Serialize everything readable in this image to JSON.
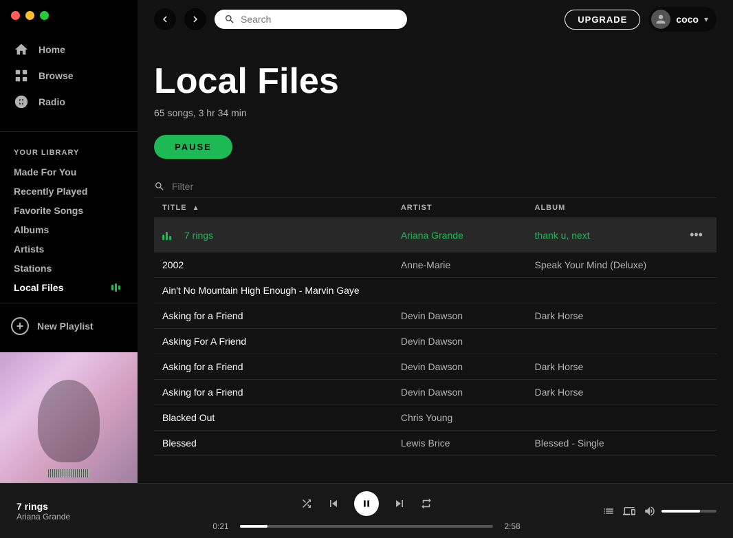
{
  "window": {
    "dots": [
      "red",
      "yellow",
      "green"
    ]
  },
  "topbar": {
    "search_placeholder": "Search",
    "upgrade_label": "UPGRADE",
    "user_name": "coco"
  },
  "sidebar": {
    "nav_items": [
      {
        "label": "Home",
        "icon": "home-icon"
      },
      {
        "label": "Browse",
        "icon": "browse-icon"
      },
      {
        "label": "Radio",
        "icon": "radio-icon"
      }
    ],
    "section_title": "YOUR LIBRARY",
    "library_items": [
      {
        "label": "Made For You",
        "key": "made-for-you"
      },
      {
        "label": "Recently Played",
        "key": "recently-played"
      },
      {
        "label": "Favorite Songs",
        "key": "favorite-songs"
      },
      {
        "label": "Albums",
        "key": "albums"
      },
      {
        "label": "Artists",
        "key": "artists"
      },
      {
        "label": "Stations",
        "key": "stations"
      },
      {
        "label": "Local Files",
        "key": "local-files",
        "active": true
      }
    ],
    "new_playlist_label": "New Playlist"
  },
  "playlist": {
    "title": "Local Files",
    "meta": "65 songs, 3 hr 34 min",
    "pause_label": "PAUSE",
    "filter_placeholder": "Filter",
    "columns": {
      "title": "TITLE",
      "artist": "ARTIST",
      "album": "ALBUM"
    },
    "tracks": [
      {
        "title": "7 rings",
        "artist": "Ariana Grande",
        "album": "thank u, next",
        "active": true
      },
      {
        "title": "2002",
        "artist": "Anne-Marie",
        "album": "Speak Your Mind (Deluxe)",
        "active": false
      },
      {
        "title": "Ain't No Mountain High Enough - Marvin Gaye",
        "artist": "",
        "album": "",
        "active": false
      },
      {
        "title": "Asking for a Friend",
        "artist": "Devin Dawson",
        "album": "Dark Horse",
        "active": false
      },
      {
        "title": "Asking For A Friend",
        "artist": "Devin Dawson",
        "album": "",
        "active": false
      },
      {
        "title": "Asking for a Friend",
        "artist": "Devin Dawson",
        "album": "Dark Horse",
        "active": false
      },
      {
        "title": "Asking for a Friend",
        "artist": "Devin Dawson",
        "album": "Dark Horse",
        "active": false
      },
      {
        "title": "Blacked Out",
        "artist": "Chris Young",
        "album": "",
        "active": false
      },
      {
        "title": "Blessed",
        "artist": "Lewis Brice",
        "album": "Blessed - Single",
        "active": false
      }
    ]
  },
  "player": {
    "track_name": "7 rings",
    "track_artist": "Ariana Grande",
    "current_time": "0:21",
    "total_time": "2:58",
    "progress_percent": 11.8
  }
}
